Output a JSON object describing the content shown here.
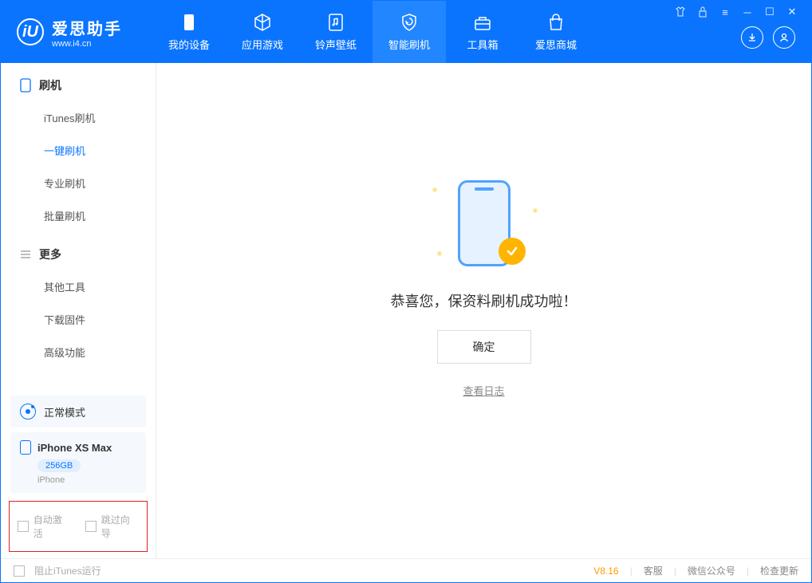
{
  "logo": {
    "char": "iU",
    "title": "爱思助手",
    "subtitle": "www.i4.cn"
  },
  "tabs": [
    {
      "label": "我的设备",
      "icon": "device"
    },
    {
      "label": "应用游戏",
      "icon": "cube"
    },
    {
      "label": "铃声壁纸",
      "icon": "music"
    },
    {
      "label": "智能刷机",
      "icon": "shield",
      "active": true
    },
    {
      "label": "工具箱",
      "icon": "toolbox"
    },
    {
      "label": "爱思商城",
      "icon": "bag"
    }
  ],
  "sidebar": {
    "section1_title": "刷机",
    "items1": [
      "iTunes刷机",
      "一键刷机",
      "专业刷机",
      "批量刷机"
    ],
    "active_index": 1,
    "section2_title": "更多",
    "items2": [
      "其他工具",
      "下载固件",
      "高级功能"
    ]
  },
  "mode": {
    "label": "正常模式"
  },
  "device": {
    "name": "iPhone XS Max",
    "storage": "256GB",
    "type": "iPhone"
  },
  "redbox": {
    "opt1": "自动激活",
    "opt2": "跳过向导"
  },
  "main": {
    "success_text": "恭喜您，保资料刷机成功啦！",
    "ok_button": "确定",
    "log_link": "查看日志"
  },
  "footer": {
    "block_itunes": "阻止iTunes运行",
    "version": "V8.16",
    "links": [
      "客服",
      "微信公众号",
      "检查更新"
    ]
  }
}
